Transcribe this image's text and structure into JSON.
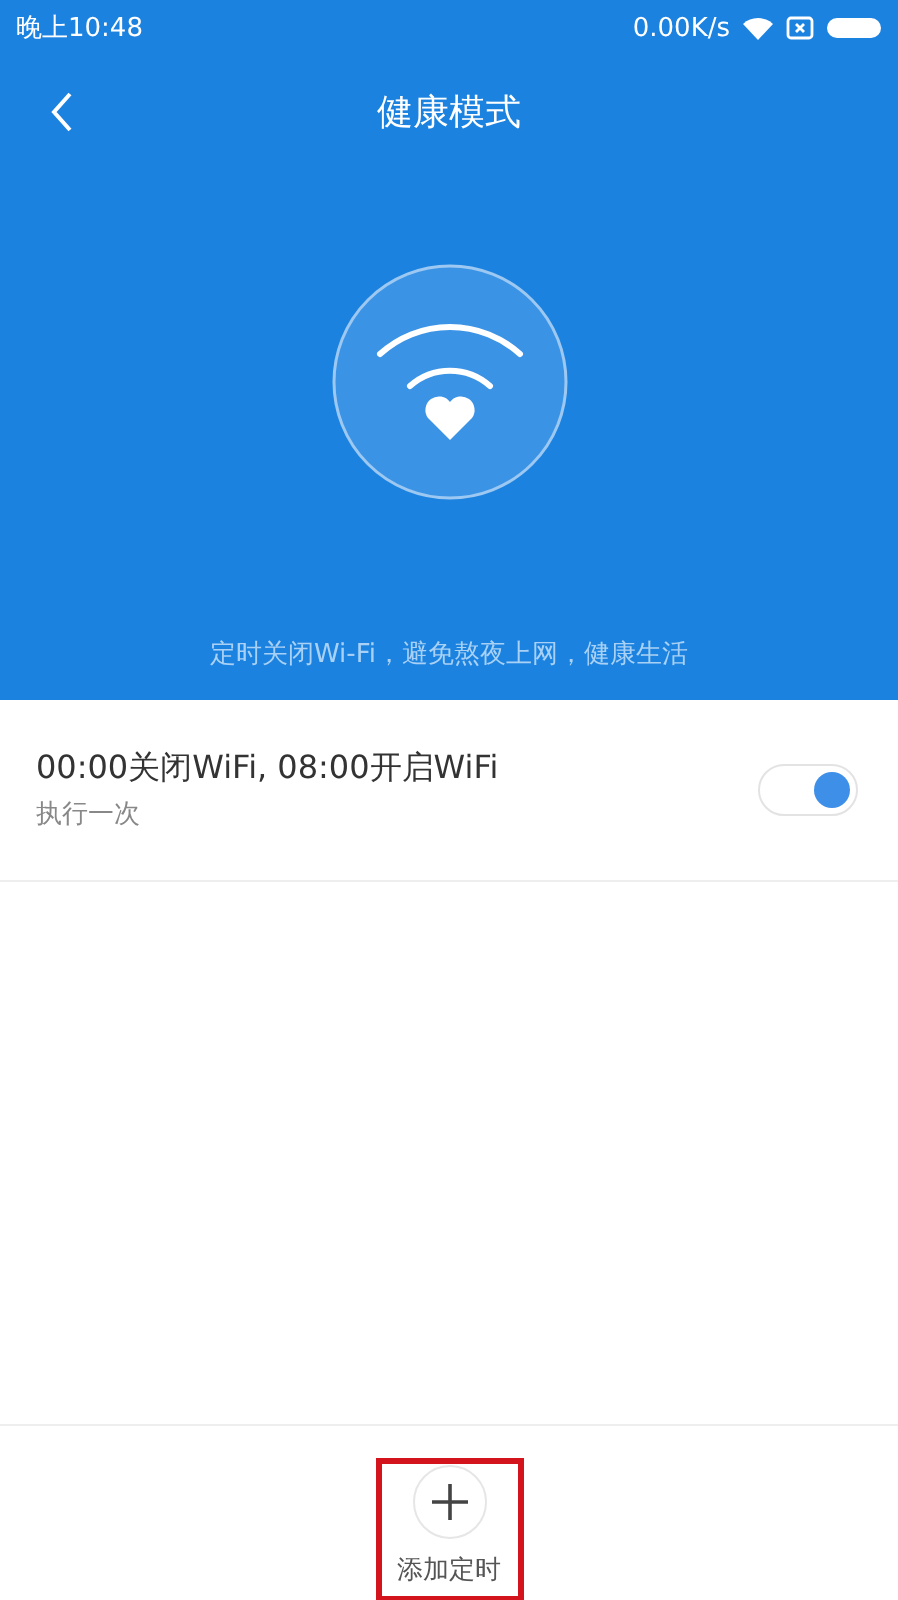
{
  "status_bar": {
    "time": "晚上10:48",
    "speed": "0.00K/s"
  },
  "header": {
    "title": "健康模式",
    "description": "定时关闭Wi-Fi，避免熬夜上网，健康生活"
  },
  "schedules": [
    {
      "title": "00:00关闭WiFi, 08:00开启WiFi",
      "repeat": "执行一次",
      "on": true
    }
  ],
  "add_button": {
    "label": "添加定时",
    "highlighted": true
  }
}
